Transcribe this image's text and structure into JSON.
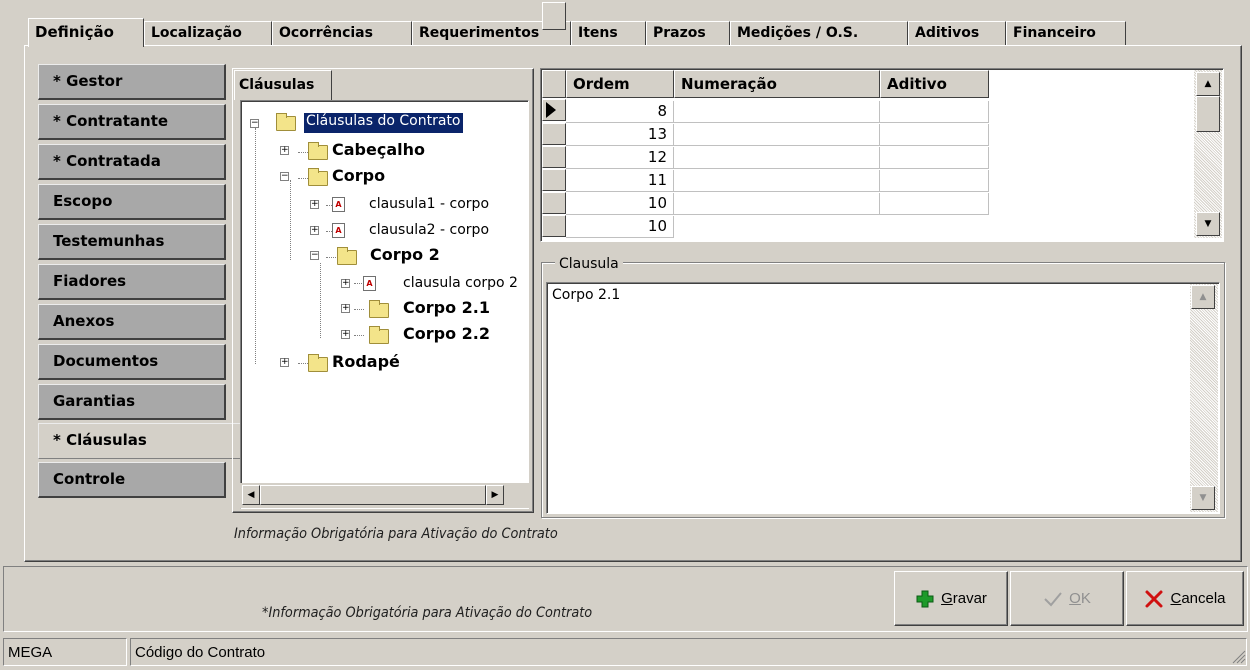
{
  "tabs": [
    {
      "label": "Definição",
      "active": true
    },
    {
      "label": "Localização"
    },
    {
      "label": "Ocorrências"
    },
    {
      "label": "Requerimentos"
    },
    {
      "label": "Itens"
    },
    {
      "label": "Prazos"
    },
    {
      "label": "Medições / O.S."
    },
    {
      "label": "Aditivos"
    },
    {
      "label": "Financeiro"
    }
  ],
  "sidebar": {
    "items": [
      {
        "label": "* Gestor"
      },
      {
        "label": "* Contratante"
      },
      {
        "label": "* Contratada"
      },
      {
        "label": "Escopo"
      },
      {
        "label": "Testemunhas"
      },
      {
        "label": "Fiadores"
      },
      {
        "label": "Anexos"
      },
      {
        "label": "Documentos"
      },
      {
        "label": "Garantias"
      },
      {
        "label": "* Cláusulas",
        "active": true
      },
      {
        "label": "Controle"
      }
    ]
  },
  "clauses": {
    "tab_label": "Cláusulas",
    "tree": {
      "root": "Cláusulas do Contrato",
      "cabecalho": "Cabeçalho",
      "corpo": "Corpo",
      "clausula1": "clausula1 - corpo",
      "clausula2": "clausula2 - corpo",
      "corpo2": "Corpo 2",
      "clausula_corpo2": "clausula corpo 2",
      "corpo21": "Corpo 2.1",
      "corpo22": "Corpo 2.2",
      "rodape": "Rodapé"
    }
  },
  "grid": {
    "columns": [
      "Ordem",
      "Numeração",
      "Aditivo"
    ],
    "rows": [
      {
        "ordem": "8",
        "numeracao": "",
        "aditivo": ""
      },
      {
        "ordem": "13",
        "numeracao": "",
        "aditivo": ""
      },
      {
        "ordem": "12",
        "numeracao": "",
        "aditivo": ""
      },
      {
        "ordem": "11",
        "numeracao": "",
        "aditivo": ""
      },
      {
        "ordem": "10",
        "numeracao": "",
        "aditivo": ""
      }
    ]
  },
  "clausula": {
    "group_label": "Clausula",
    "text": "Corpo 2.1"
  },
  "notes": {
    "mandatory_inner": "Informação Obrigatória para Ativação do Contrato",
    "mandatory_bottom": "*Informação Obrigatória para Ativação do Contrato"
  },
  "buttons": {
    "save": {
      "prefix": "",
      "underline": "G",
      "rest": "ravar"
    },
    "ok": {
      "prefix": "",
      "underline": "O",
      "rest": "K"
    },
    "cancel": {
      "prefix": "",
      "underline": "C",
      "rest": "ancela"
    }
  },
  "status": {
    "left": "MEGA",
    "right": "Código do Contrato"
  },
  "colors": {
    "face": "#d4d0c8",
    "nav_inactive": "#a8a8a8",
    "selected_node": "#0a246a",
    "save_icon": "#1e9a2a",
    "cancel_icon": "#d01010"
  }
}
